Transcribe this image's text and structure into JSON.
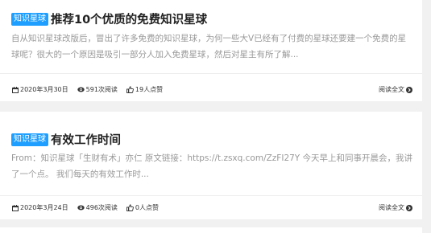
{
  "posts": [
    {
      "category": "知识星球",
      "title": "推荐10个优质的免费知识星球",
      "excerpt": "自从知识星球改版后，冒出了许多免费的知识星球，为何一些大V已经有了付费的星球还要建一个免费的星球呢？很大的一个原因是吸引一部分人加入免费星球，然后对星主有所了解...",
      "date": "2020年3月30日",
      "views": "591次阅读",
      "likes": "19人点赞",
      "read_more": "阅读全文"
    },
    {
      "category": "知识星球",
      "title": "有效工作时间",
      "excerpt": "From：知识星球「生财有术」亦仁 原文链接：https://t.zsxq.com/ZzFI27Y 今天早上和同事开晨会，我讲了一个点。 我们每天的有效工作时...",
      "date": "2020年3月24日",
      "views": "496次阅读",
      "likes": "0人点赞",
      "read_more": "阅读全文"
    }
  ],
  "colors": {
    "badge": "#1e9fff",
    "excerpt": "#999999",
    "background": "#f1f1f1"
  },
  "icons": [
    "calendar-icon",
    "eye-icon",
    "thumbs-up-icon",
    "arrow-circle-right-icon"
  ]
}
